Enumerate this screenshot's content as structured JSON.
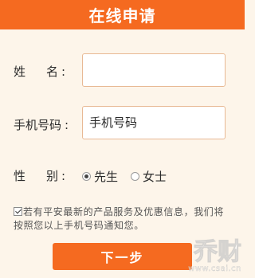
{
  "header": {
    "title": "在线申请"
  },
  "form": {
    "name": {
      "label_char1": "姓",
      "label_char2": "名",
      "colon": ":",
      "value": ""
    },
    "phone": {
      "label": "手机号码",
      "colon": ":",
      "placeholder": "手机号码"
    },
    "gender": {
      "label_char1": "性",
      "label_char2": "别",
      "colon": ":",
      "options": [
        {
          "label": "先生",
          "checked": true
        },
        {
          "label": "女士",
          "checked": false
        }
      ]
    },
    "consent": {
      "checked": true,
      "text": "若有平安最新的产品服务及优惠信息，我们将按照您以上手机号码通知您。"
    },
    "submit_label": "下一步"
  },
  "watermark": {
    "logo": "乔财",
    "domain": "www.csai.cn"
  },
  "colors": {
    "accent": "#f56a20",
    "background": "#fdf5ea",
    "input_border": "#e8b994"
  }
}
